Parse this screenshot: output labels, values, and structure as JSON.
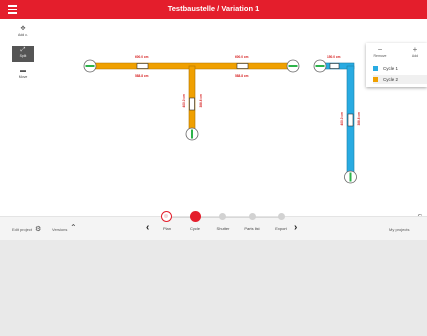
{
  "header": {
    "title": "Testbaustelle / Variation 1"
  },
  "toolbar": {
    "tools": [
      {
        "label": "Add c."
      },
      {
        "label": "Split"
      },
      {
        "label": "Move"
      }
    ]
  },
  "legend": {
    "remove_label": "Remove",
    "add_label": "Add",
    "cycles": [
      {
        "name": "Cycle 1",
        "color": "#29abe2"
      },
      {
        "name": "Cycle 2",
        "color": "#f0a000"
      }
    ]
  },
  "zoom": {
    "label": "100%"
  },
  "measurements": {
    "left_top": "600.0 cm",
    "left_bottom": "588.8 cm",
    "right_top": "600.0 cm",
    "right_bottom": "588.8 cm",
    "vertical_left": "400.0 cm",
    "vertical_right": "388.8 cm",
    "cycle1_top": "150.0 cm",
    "cycle1_vertical_left": "400.0 cm",
    "cycle1_vertical_right": "388.8 cm"
  },
  "bottombar": {
    "edit_project": "Edit project",
    "versions": "Versions",
    "my_projects": "My projects",
    "steps": [
      "Plan",
      "Cycle",
      "Shutter",
      "Parts list",
      "Export"
    ],
    "active_step": 1
  },
  "colors": {
    "accent": "#e41e2c",
    "cycle_orange": "#f0a000",
    "cycle_blue": "#29abe2",
    "inlet_green": "#2db34a"
  }
}
